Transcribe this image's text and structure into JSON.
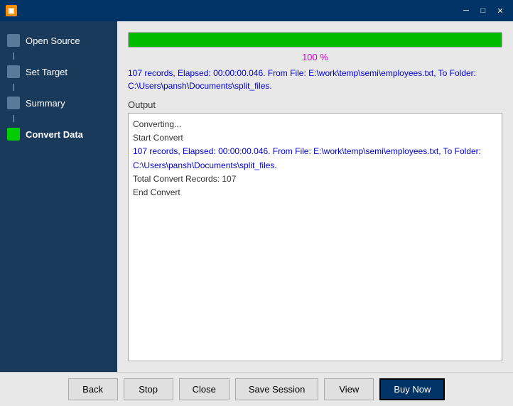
{
  "titleBar": {
    "icon": "▣",
    "title": "",
    "minimizeLabel": "─",
    "maximizeLabel": "□",
    "closeLabel": "✕"
  },
  "sidebar": {
    "items": [
      {
        "id": "open-source",
        "label": "Open Source",
        "iconType": "normal",
        "active": false
      },
      {
        "id": "set-target",
        "label": "Set Target",
        "iconType": "normal",
        "active": false
      },
      {
        "id": "summary",
        "label": "Summary",
        "iconType": "normal",
        "active": false
      },
      {
        "id": "convert-data",
        "label": "Convert Data",
        "iconType": "green",
        "active": true
      }
    ]
  },
  "progress": {
    "percent": "100 %",
    "infoLine1": "107 records,   Elapsed: 00:00:00.046.   From File: E:\\work\\temp\\semi\\employees.txt,   To Folder:",
    "infoLine2": "C:\\Users\\pansh\\Documents\\split_files."
  },
  "output": {
    "label": "Output",
    "lines": [
      {
        "text": "Converting...",
        "color": "normal"
      },
      {
        "text": "Start Convert",
        "color": "normal"
      },
      {
        "text": "107 records,   Elapsed: 00:00:00.046.   From File: E:\\work\\temp\\semi\\employees.txt,   To Folder:",
        "color": "blue"
      },
      {
        "text": "C:\\Users\\pansh\\Documents\\split_files.",
        "color": "blue"
      },
      {
        "text": "Total Convert Records: 107",
        "color": "normal"
      },
      {
        "text": "End Convert",
        "color": "normal"
      }
    ]
  },
  "buttons": {
    "back": "Back",
    "stop": "Stop",
    "close": "Close",
    "saveSession": "Save Session",
    "view": "View",
    "buyNow": "Buy Now"
  }
}
